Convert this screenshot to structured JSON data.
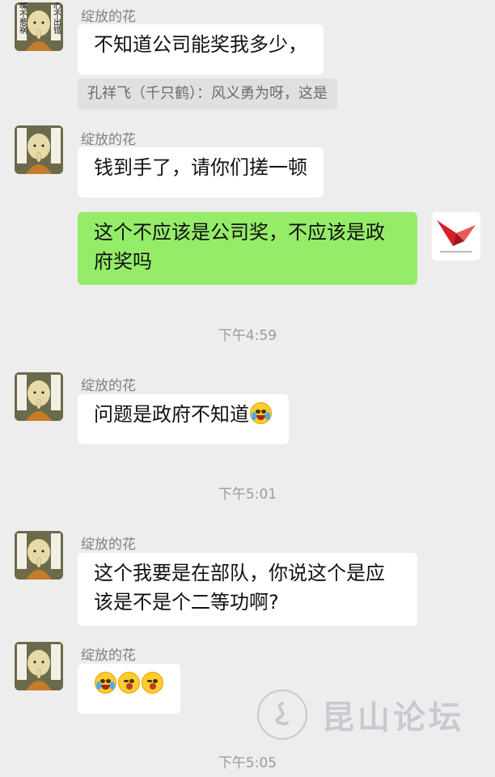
{
  "messages": [
    {
      "sender": "绽放的花",
      "text": "不知道公司能奖我多少，"
    },
    {
      "quote": "孔祥飞（千只鹤）：风义勇为呀，这是"
    },
    {
      "sender": "绽放的花",
      "text": "钱到手了，请你们搓一顿"
    },
    {
      "self_text_line1": "这个不应该是公司奖，不应该是政",
      "self_text_line2": "府奖吗"
    },
    {
      "time": "下午4:59"
    },
    {
      "sender": "绽放的花",
      "text": "问题是政府不知道"
    },
    {
      "time": "下午5:01"
    },
    {
      "sender": "绽放的花",
      "text_line1": "这个我要是在部队，你说这个是应",
      "text_line2": "该是不是个二等功啊?"
    },
    {
      "sender": "绽放的花"
    },
    {
      "time": "下午5:05"
    }
  ],
  "avatar_text": {
    "left_column": "守嘴不惹祸",
    "right_column": "守心不出错"
  },
  "watermark": {
    "text": "昆山论坛"
  },
  "icons": {
    "emoji_cry": "loudly-crying-face-icon",
    "emoji_wink": "winking-tongue-face-icon",
    "self_avatar": "paper-crane-logo-icon"
  },
  "colors": {
    "background": "#ededed",
    "incoming_bubble": "#ffffff",
    "outgoing_bubble": "#95ec69"
  }
}
